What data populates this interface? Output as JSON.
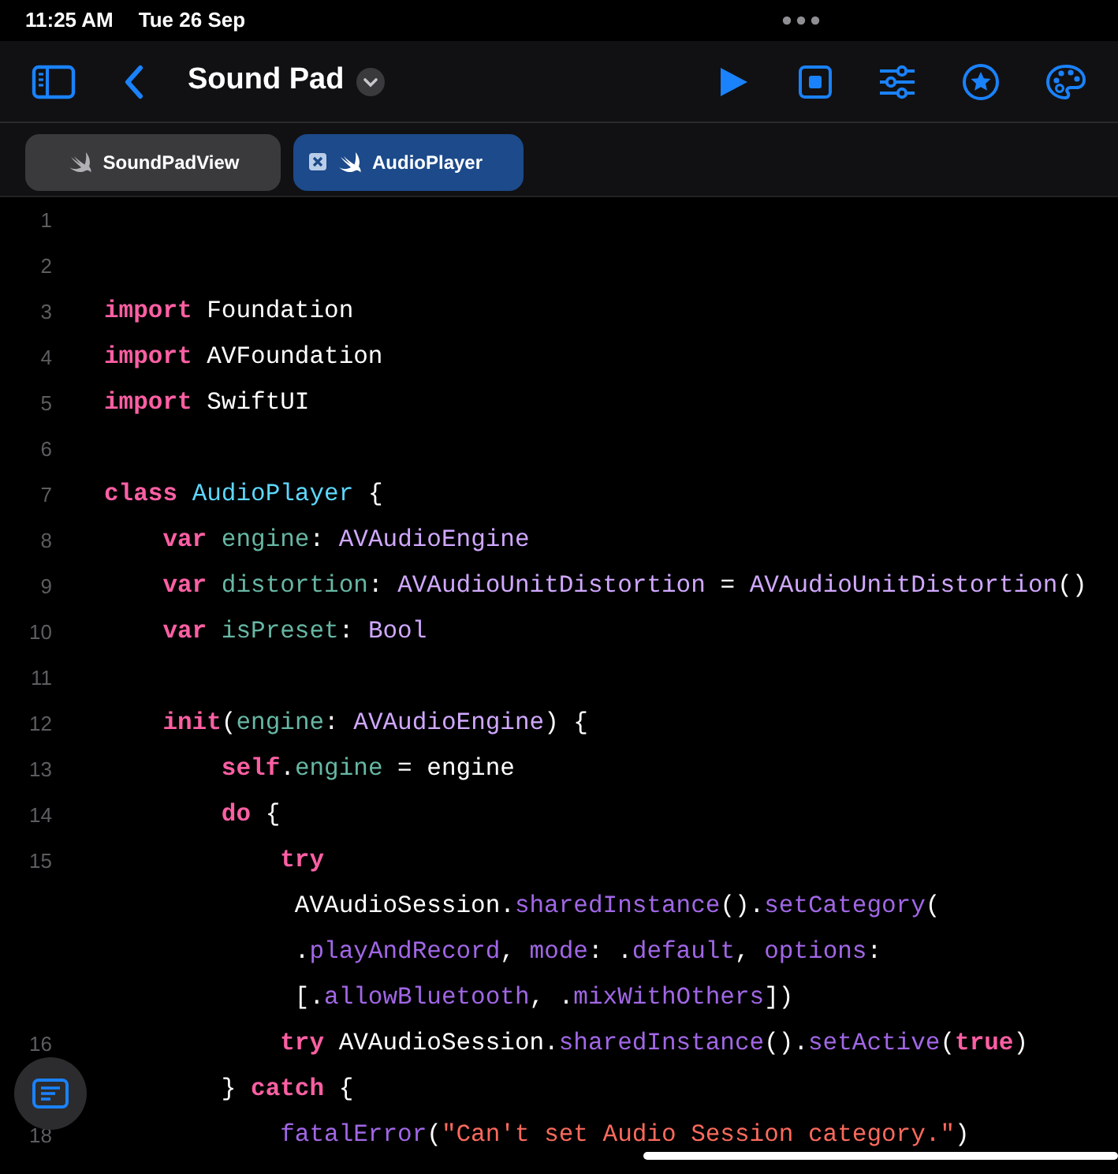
{
  "status_bar": {
    "time": "11:25 AM",
    "date": "Tue 26 Sep"
  },
  "toolbar": {
    "title": "Sound Pad"
  },
  "tabs": [
    {
      "label": "SoundPadView",
      "selected": false
    },
    {
      "label": "AudioPlayer",
      "selected": true
    }
  ],
  "code_lines": [
    {
      "number": "1"
    },
    {
      "number": "2"
    },
    {
      "number": "3",
      "tokens": [
        {
          "kind": "keyword",
          "text": "import"
        },
        {
          "kind": "plain",
          "text": " Foundation"
        }
      ]
    },
    {
      "number": "4",
      "tokens": [
        {
          "kind": "keyword",
          "text": "import"
        },
        {
          "kind": "plain",
          "text": " AVFoundation"
        }
      ]
    },
    {
      "number": "5",
      "tokens": [
        {
          "kind": "keyword",
          "text": "import"
        },
        {
          "kind": "plain",
          "text": " SwiftUI"
        }
      ]
    },
    {
      "number": "6"
    },
    {
      "number": "7",
      "tokens": [
        {
          "kind": "keyword",
          "text": "class"
        },
        {
          "kind": "declaration",
          "text": " AudioPlayer"
        },
        {
          "kind": "plain",
          "text": " {"
        }
      ]
    },
    {
      "number": "8",
      "tokens": [
        {
          "kind": "keyword",
          "text": "    var"
        },
        {
          "kind": "property",
          "text": " engine"
        },
        {
          "kind": "plain",
          "text": ": "
        },
        {
          "kind": "type",
          "text": "AVAudioEngine"
        }
      ]
    },
    {
      "number": "9",
      "tokens": [
        {
          "kind": "keyword",
          "text": "    var"
        },
        {
          "kind": "property",
          "text": " distortion"
        },
        {
          "kind": "plain",
          "text": ": "
        },
        {
          "kind": "type",
          "text": "AVAudioUnitDistortion"
        },
        {
          "kind": "plain",
          "text": " = "
        },
        {
          "kind": "type",
          "text": "AVAudioUnitDistortion"
        },
        {
          "kind": "plain",
          "text": "()"
        }
      ]
    },
    {
      "number": "10",
      "tokens": [
        {
          "kind": "keyword",
          "text": "    var"
        },
        {
          "kind": "property",
          "text": " isPreset"
        },
        {
          "kind": "plain",
          "text": ": "
        },
        {
          "kind": "type",
          "text": "Bool"
        }
      ]
    },
    {
      "number": "11"
    },
    {
      "number": "12",
      "tokens": [
        {
          "kind": "keyword",
          "text": "    init"
        },
        {
          "kind": "plain",
          "text": "("
        },
        {
          "kind": "property",
          "text": "engine"
        },
        {
          "kind": "plain",
          "text": ": "
        },
        {
          "kind": "type",
          "text": "AVAudioEngine"
        },
        {
          "kind": "plain",
          "text": ") {"
        }
      ]
    },
    {
      "number": "13",
      "tokens": [
        {
          "kind": "keyword",
          "text": "        self"
        },
        {
          "kind": "plain",
          "text": "."
        },
        {
          "kind": "property",
          "text": "engine"
        },
        {
          "kind": "plain",
          "text": " = engine"
        }
      ]
    },
    {
      "number": "14",
      "tokens": [
        {
          "kind": "keyword",
          "text": "        do"
        },
        {
          "kind": "plain",
          "text": " {"
        }
      ]
    },
    {
      "number": "15",
      "tokens": [
        {
          "kind": "keyword",
          "text": "            try"
        }
      ]
    },
    {
      "tokens": [
        {
          "kind": "plain",
          "text": "             AVAudioSession."
        },
        {
          "kind": "method",
          "text": "sharedInstance"
        },
        {
          "kind": "plain",
          "text": "()."
        },
        {
          "kind": "method",
          "text": "setCategory"
        },
        {
          "kind": "plain",
          "text": "("
        }
      ]
    },
    {
      "tokens": [
        {
          "kind": "plain",
          "text": "             ."
        },
        {
          "kind": "method",
          "text": "playAndRecord"
        },
        {
          "kind": "plain",
          "text": ", "
        },
        {
          "kind": "method",
          "text": "mode"
        },
        {
          "kind": "plain",
          "text": ": ."
        },
        {
          "kind": "method",
          "text": "default"
        },
        {
          "kind": "plain",
          "text": ", "
        },
        {
          "kind": "method",
          "text": "options"
        },
        {
          "kind": "plain",
          "text": ":"
        }
      ]
    },
    {
      "tokens": [
        {
          "kind": "plain",
          "text": "             [."
        },
        {
          "kind": "method",
          "text": "allowBluetooth"
        },
        {
          "kind": "plain",
          "text": ", ."
        },
        {
          "kind": "method",
          "text": "mixWithOthers"
        },
        {
          "kind": "plain",
          "text": "])"
        }
      ]
    },
    {
      "number": "16",
      "tokens": [
        {
          "kind": "keyword",
          "text": "            try"
        },
        {
          "kind": "plain",
          "text": " AVAudioSession."
        },
        {
          "kind": "method",
          "text": "sharedInstance"
        },
        {
          "kind": "plain",
          "text": "()."
        },
        {
          "kind": "method",
          "text": "setActive"
        },
        {
          "kind": "plain",
          "text": "("
        },
        {
          "kind": "keyword",
          "text": "true"
        },
        {
          "kind": "plain",
          "text": ")"
        }
      ]
    },
    {
      "tokens": [
        {
          "kind": "plain",
          "text": "        }"
        },
        {
          "kind": "keyword",
          "text": " catch"
        },
        {
          "kind": "plain",
          "text": " {"
        }
      ]
    },
    {
      "number": "18",
      "tokens": [
        {
          "kind": "method",
          "text": "            fatalError"
        },
        {
          "kind": "plain",
          "text": "("
        },
        {
          "kind": "string",
          "text": "\"Can't set Audio Session category.\""
        },
        {
          "kind": "plain",
          "text": ")"
        }
      ]
    }
  ]
}
